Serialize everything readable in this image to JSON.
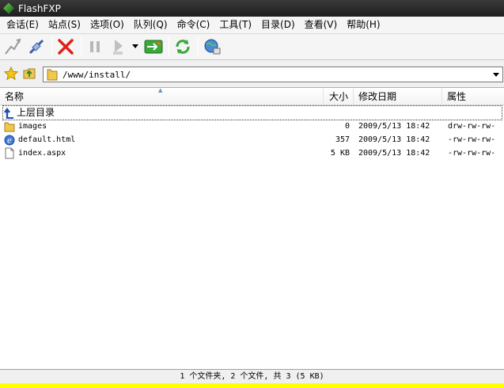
{
  "window": {
    "title": "FlashFXP"
  },
  "menu": {
    "items": [
      "会话(E)",
      "站点(S)",
      "选项(O)",
      "队列(Q)",
      "命令(C)",
      "工具(T)",
      "目录(D)",
      "查看(V)",
      "帮助(H)"
    ]
  },
  "toolbar": {
    "icons": [
      "connect-icon",
      "quick-connect-icon",
      "abort-icon",
      "pause-icon",
      "transfer-queue-icon",
      "dropdown-icon",
      "transfer-icon",
      "refresh-icon",
      "site-manager-icon"
    ]
  },
  "pathbar": {
    "path": "/www/install/"
  },
  "columns": {
    "name": "名称",
    "size": "大小",
    "modified": "修改日期",
    "attributes": "属性"
  },
  "files": [
    {
      "name": "上层目录",
      "size": "",
      "modified": "",
      "attributes": "",
      "icon": "parent-dir-icon"
    },
    {
      "name": "images",
      "size": "0",
      "modified": "2009/5/13 18:42",
      "attributes": "drw-rw-rw-",
      "icon": "folder-icon"
    },
    {
      "name": "default.html",
      "size": "357",
      "modified": "2009/5/13 18:42",
      "attributes": "-rw-rw-rw-",
      "icon": "html-file-icon"
    },
    {
      "name": "index.aspx",
      "size": "5 KB",
      "modified": "2009/5/13 18:42",
      "attributes": "-rw-rw-rw-",
      "icon": "file-icon"
    }
  ],
  "status": {
    "text": "1 个文件夹, 2 个文件, 共 3 (5 KB)"
  },
  "colors": {
    "titlebar": "#2a2a2a",
    "status_highlight": "#ffff00",
    "abort_red": "#e0201a",
    "accent_green": "#3aa83a"
  }
}
